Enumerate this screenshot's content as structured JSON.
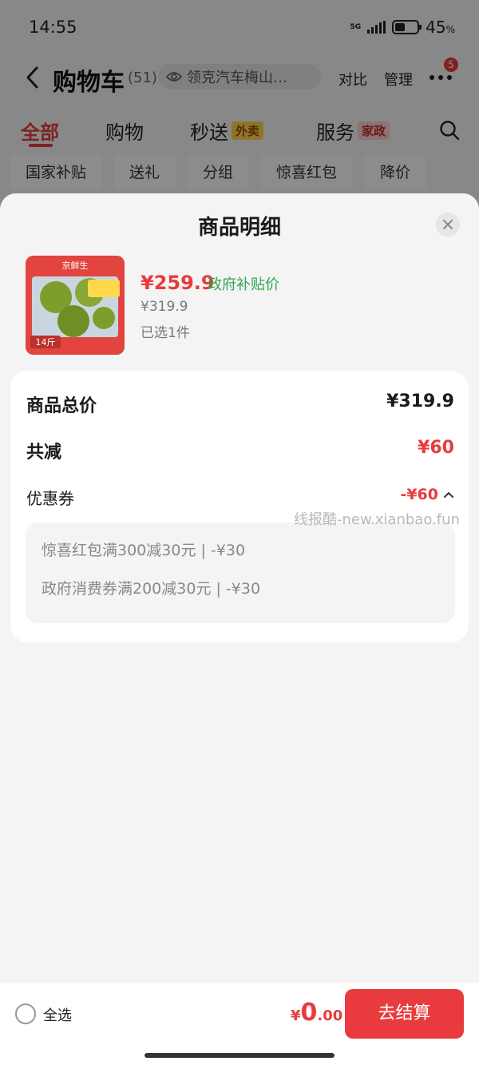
{
  "status_bar": {
    "time": "14:55",
    "network": "5G",
    "battery": "45",
    "battery_unit": "%"
  },
  "nav": {
    "title": "购物车",
    "count": "(51)",
    "address": "领克汽车梅山…",
    "compare": "对比",
    "manage": "管理",
    "badge": "5"
  },
  "tabs": [
    {
      "label": "全部"
    },
    {
      "label": "购物"
    },
    {
      "label": "秒送",
      "tag": "外卖"
    },
    {
      "label": "服务",
      "tag": "家政"
    }
  ],
  "chips": [
    "国家补贴",
    "送礼",
    "分组",
    "惊喜红包",
    "降价"
  ],
  "sheet": {
    "title": "商品明细",
    "product": {
      "price": "¥259.9",
      "price_tag": "政府补贴价",
      "original_price": "¥319.9",
      "selected": "已选1件",
      "image_brand": "京鲜生",
      "image_weight": "14斤"
    },
    "summary": {
      "total_label": "商品总价",
      "total_value": "¥319.9",
      "reduce_label": "共减",
      "reduce_value": "¥60",
      "coupon_label": "优惠券",
      "coupon_value": "-¥60",
      "coupon_lines": [
        "惊喜红包满300减30元 | -¥30",
        "政府消费券满200减30元 | -¥30"
      ]
    },
    "watermark": "线报酷-new.xianbao.fun"
  },
  "bottom_bar": {
    "select_all": "全选",
    "currency": "¥",
    "total_int": "0",
    "total_dec": ".00",
    "checkout": "去结算"
  },
  "colors": {
    "accent": "#e93b3d",
    "green": "#2ea44f"
  }
}
